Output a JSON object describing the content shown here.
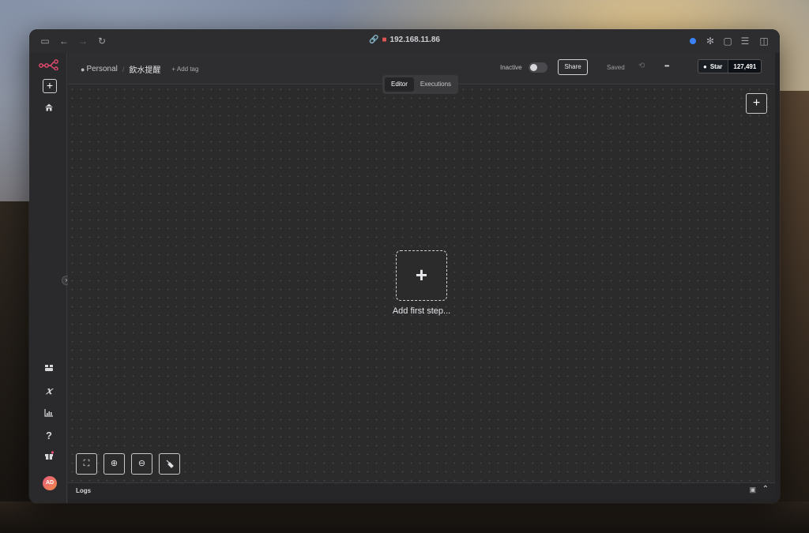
{
  "titlebar": {
    "address": "192.168.11.86"
  },
  "header": {
    "breadcrumb_project": "Personal",
    "breadcrumb_separator": "/",
    "workflow_name": "飲水提醒",
    "add_tag": "+ Add tag",
    "active_label": "Inactive",
    "share_label": "Share",
    "saved_label": "Saved",
    "more_label": "•••",
    "github_star_label": "Star",
    "github_star_count": "127,491"
  },
  "tabs": [
    {
      "label": "Editor",
      "active": true
    },
    {
      "label": "Executions",
      "active": false
    }
  ],
  "canvas": {
    "add_first_step_label": "Add first step..."
  },
  "sidebar": {
    "avatar_initials": "AD",
    "icons": [
      "n8n-logo-icon",
      "plus-icon",
      "home-icon",
      "templates-icon",
      "variables-icon",
      "insights-icon",
      "help-icon",
      "gift-icon"
    ]
  },
  "logs": {
    "label": "Logs"
  },
  "colors": {
    "accent": "#ea4b71",
    "background": "#2b2b2c"
  }
}
